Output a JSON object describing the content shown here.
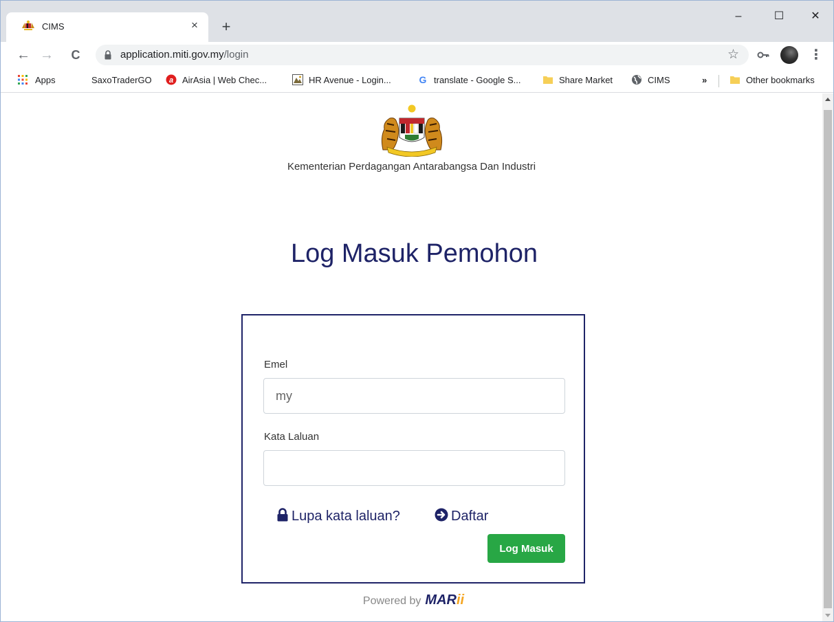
{
  "browser": {
    "tab": {
      "title": "CIMS",
      "close": "×",
      "favicon": "malaysia-crest-icon"
    },
    "new_tab": "+",
    "window_controls": {
      "minimize": "–",
      "maximize": "☐",
      "close": "✕"
    },
    "nav": {
      "back": "←",
      "forward": "→",
      "reload": "C"
    },
    "address": {
      "host": "application.miti.gov.my",
      "path": "/login"
    },
    "bookmark_star": "☆",
    "menu": "⋮",
    "bookmarks": [
      {
        "label": "Apps",
        "icon": "apps-grid-icon"
      },
      {
        "label": "SaxoTraderGO",
        "icon": "none"
      },
      {
        "label": "AirAsia | Web Chec...",
        "icon": "airasia-icon"
      },
      {
        "label": "HR Avenue - Login...",
        "icon": "hr-avenue-icon"
      },
      {
        "label": "translate - Google S...",
        "icon": "google-icon"
      },
      {
        "label": "Share Market",
        "icon": "folder-icon"
      },
      {
        "label": "CIMS",
        "icon": "globe-icon"
      }
    ],
    "bookmarks_overflow": "»",
    "other_bookmarks": "Other bookmarks"
  },
  "page": {
    "ministry": "Kementerian Perdagangan Antarabangsa Dan Industri",
    "title": "Log Masuk Pemohon",
    "form": {
      "email_label": "Emel",
      "email_value": "my",
      "password_label": "Kata Laluan",
      "password_value": "",
      "forgot_link": "Lupa kata laluan?",
      "register_link": "Daftar",
      "submit": "Log Masuk"
    },
    "footer": {
      "powered_by": "Powered by",
      "brand": "MAR",
      "brand_suffix": "ii"
    }
  },
  "colors": {
    "primary": "#1e2367",
    "success": "#28a745",
    "tabstrip": "#dee1e6"
  }
}
